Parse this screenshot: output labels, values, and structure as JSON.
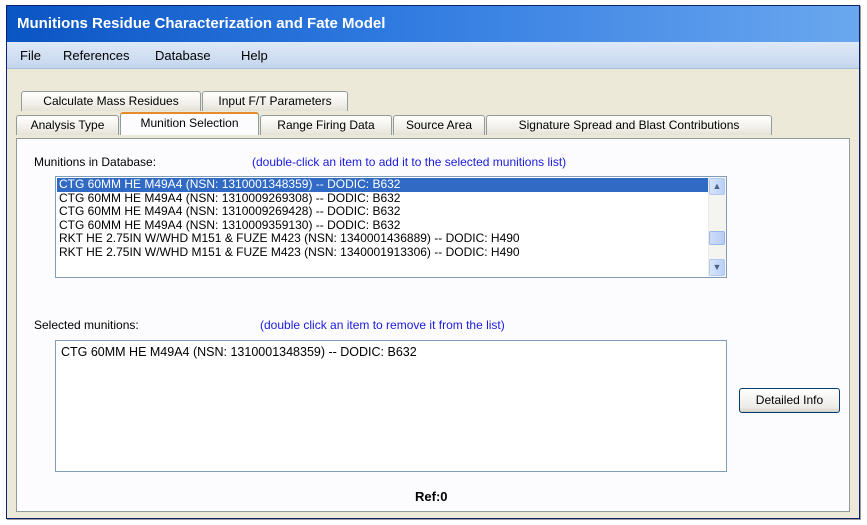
{
  "window": {
    "title": "Munitions Residue Characterization and Fate Model"
  },
  "menu": [
    "File",
    "References",
    "Database",
    "Help"
  ],
  "tabs_row_back": [
    "Calculate Mass Residues",
    "Input F/T Parameters"
  ],
  "tabs_row_front": [
    "Analysis Type",
    "Munition Selection",
    "Range Firing Data",
    "Source Area",
    "Signature Spread and Blast Contributions"
  ],
  "active_tab": "Munition Selection",
  "database_list": {
    "label": "Munitions in Database:",
    "hint": "(double-click an item to add it to the selected munitions list)",
    "items": [
      "CTG 60MM HE M49A4 (NSN: 1310001348359) -- DODIC: B632",
      "CTG 60MM HE M49A4 (NSN: 1310009269308) -- DODIC: B632",
      "CTG 60MM HE M49A4 (NSN: 1310009269428) -- DODIC: B632",
      "CTG 60MM HE M49A4 (NSN: 1310009359130) -- DODIC: B632",
      "RKT HE 2.75IN W/WHD M151 & FUZE M423 (NSN: 1340001436889) -- DODIC: H490",
      "RKT HE 2.75IN W/WHD M151 & FUZE M423 (NSN: 1340001913306) -- DODIC: H490"
    ],
    "selected_index": 0
  },
  "selected_list": {
    "label": "Selected munitions:",
    "hint": "(double click an item to remove it from the list)",
    "items": [
      "CTG 60MM HE M49A4 (NSN: 1310001348359) -- DODIC: B632"
    ]
  },
  "buttons": {
    "detailed_info": "Detailed Info"
  },
  "ref_text": "Ref:0",
  "icons": {
    "scroll_up": "▲",
    "scroll_down": "▼"
  }
}
